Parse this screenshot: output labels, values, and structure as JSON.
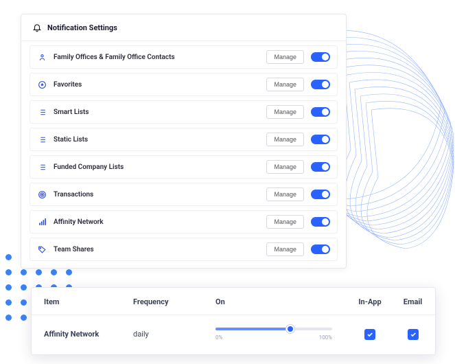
{
  "panel": {
    "title": "Notification Settings",
    "manage_label": "Manage",
    "items": [
      {
        "name": "family-offices",
        "label": "Family Offices & Family Office Contacts",
        "icon": "person"
      },
      {
        "name": "favorites",
        "label": "Favorites",
        "icon": "star-circle"
      },
      {
        "name": "smart-lists",
        "label": "Smart Lists",
        "icon": "list"
      },
      {
        "name": "static-lists",
        "label": "Static Lists",
        "icon": "list"
      },
      {
        "name": "funded-company-lists",
        "label": "Funded Company Lists",
        "icon": "list"
      },
      {
        "name": "transactions",
        "label": "Transactions",
        "icon": "target"
      },
      {
        "name": "affinity-network",
        "label": "Affinity Network",
        "icon": "signal"
      },
      {
        "name": "team-shares",
        "label": "Team Shares",
        "icon": "tag"
      }
    ]
  },
  "detail": {
    "headers": {
      "item": "Item",
      "frequency": "Frequency",
      "on": "On",
      "in_app": "In-App",
      "email": "Email"
    },
    "row": {
      "item": "Affinity Network",
      "frequency": "daily",
      "slider_min_label": "0%",
      "slider_max_label": "100%",
      "in_app_checked": true,
      "email_checked": true
    }
  },
  "colors": {
    "accent": "#2a62ff"
  }
}
